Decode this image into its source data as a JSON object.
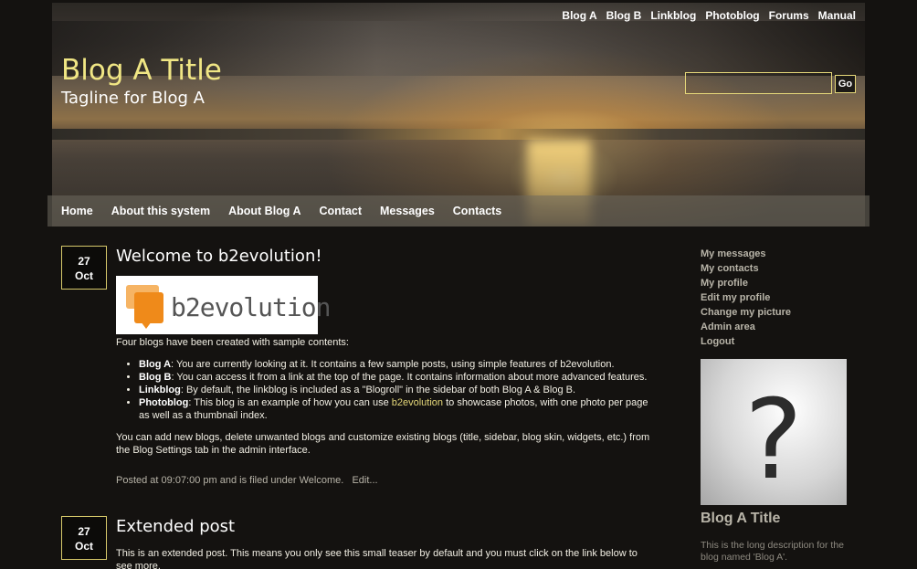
{
  "header": {
    "top_nav": [
      "Blog A",
      "Blog B",
      "Linkblog",
      "Photoblog",
      "Forums",
      "Manual"
    ],
    "blog_title": "Blog A Title",
    "tagline": "Tagline for Blog A",
    "search_placeholder": "",
    "search_button": "Go"
  },
  "main_nav": [
    "Home",
    "About this system",
    "About Blog A",
    "Contact",
    "Messages",
    "Contacts"
  ],
  "posts": [
    {
      "day": "27",
      "month": "Oct",
      "title": "Welcome to b2evolution!",
      "logo_text": "b2evolution",
      "intro": "Four blogs have been created with sample contents:",
      "items": [
        {
          "name": "Blog A",
          "text": ": You are currently looking at it. It contains a few sample posts, using simple features of b2evolution."
        },
        {
          "name": "Blog B",
          "text": ": You can access it from a link at the top of the page. It contains information about more advanced features."
        },
        {
          "name": "Linkblog",
          "text": ": By default, the linkblog is included as a \"Blogroll\" in the sidebar of both Blog A & Blog B."
        },
        {
          "name": "Photoblog",
          "text_before": ": This blog is an example of how you can use ",
          "link": "b2evolution",
          "text_after": " to showcase photos, with one photo per page as well as a thumbnail index."
        }
      ],
      "outro": "You can add new blogs, delete unwanted blogs and customize existing blogs (title, sidebar, blog skin, widgets, etc.) from the Blog Settings tab in the admin interface.",
      "meta": "Posted at 09:07:00 pm and is filed under Welcome.",
      "edit": "Edit..."
    },
    {
      "day": "27",
      "month": "Oct",
      "title": "Extended post",
      "teaser": "This is an extended post. This means you only see this small teaser by default and you must click on the link below to see more."
    }
  ],
  "sidebar": {
    "menu": [
      "My messages",
      "My contacts",
      "My profile",
      "Edit my profile",
      "Change my picture",
      "Admin area",
      "Logout"
    ],
    "avatar_icon": "question-mark-icon",
    "blog_title": "Blog A Title",
    "blog_desc": "This is the long description for the blog named 'Blog A'."
  },
  "colors": {
    "title": "#f0e684",
    "accent": "#e6d87a",
    "background": "#141210"
  }
}
